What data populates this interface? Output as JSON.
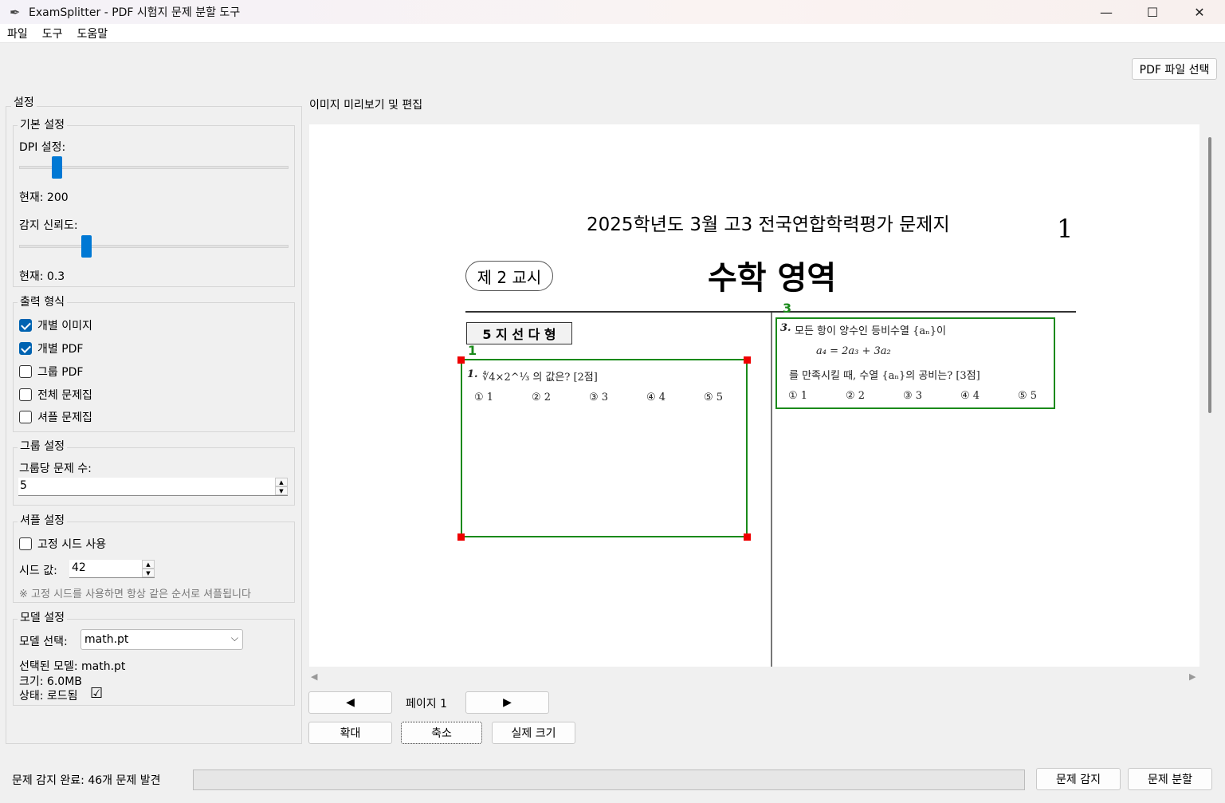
{
  "window": {
    "title": "ExamSplitter - PDF 시험지 문제 분할 도구",
    "minimize": "—",
    "maximize": "☐",
    "close": "✕"
  },
  "menu": [
    "파일",
    "도구",
    "도움말"
  ],
  "top": {
    "pdf_select": "PDF 파일 선택"
  },
  "settings": {
    "title": "설정",
    "basic": {
      "title": "기본 설정",
      "dpi_label": "DPI 설정:",
      "dpi_value": "현재: 200",
      "dpi_level": 0.12,
      "conf_label": "감지 신뢰도:",
      "conf_value": "현재: 0.3",
      "conf_level": 0.23
    },
    "output": {
      "title": "출력 형식",
      "options": [
        {
          "label": "개별 이미지",
          "checked": true
        },
        {
          "label": "개별 PDF",
          "checked": true
        },
        {
          "label": "그룹 PDF",
          "checked": false
        },
        {
          "label": "전체 문제집",
          "checked": false
        },
        {
          "label": "셔플 문제집",
          "checked": false
        }
      ]
    },
    "group": {
      "title": "그룹 설정",
      "count_label": "그룹당 문제 수:",
      "count_value": "5"
    },
    "shuffle": {
      "title": "셔플 설정",
      "fixed_seed": "고정 시드 사용",
      "seed_label": "시드 값:",
      "seed_value": "42",
      "note": "※ 고정 시드를 사용하면 항상 같은 순서로 셔플됩니다"
    },
    "model": {
      "title": "모델 설정",
      "select_label": "모델 선택:",
      "select_value": "math.pt",
      "selected": "선택된 모델: math.pt",
      "size": "크기: 6.0MB",
      "status": "상태: 로드됨",
      "status_icon": "☑"
    }
  },
  "preview": {
    "title": "이미지 미리보기 및 편집",
    "exam": {
      "header": "2025학년도 3월 고3 전국연합학력평가 문제지",
      "page_no": "1",
      "session": "제 2 교시",
      "subject": "수학 영역",
      "type_box": "5 지 선 다 형",
      "q1_num": "1.",
      "q1_text": "∜4×2^⅓ 의 값은? [2점]",
      "q1_choices": [
        "① 1",
        "② 2",
        "③ 3",
        "④ 4",
        "⑤ 5"
      ],
      "q3_num": "3.",
      "q3_line1": "모든 항이 양수인 등비수열 {aₙ}이",
      "q3_line2": "a₄ = 2a₃ + 3a₂",
      "q3_line3": "를 만족시킬 때, 수열 {aₙ}의 공비는? [3점]",
      "q3_choices": [
        "① 1",
        "② 2",
        "③ 3",
        "④ 4",
        "⑤ 5"
      ],
      "box_labels": [
        "1",
        "3"
      ]
    },
    "nav": {
      "prev": "◀",
      "page": "페이지 1",
      "next": "▶"
    },
    "zoom": {
      "in": "확대",
      "out": "축소",
      "actual": "실제 크기"
    }
  },
  "status": {
    "text": "문제 감지 완료: 46개 문제 발견",
    "detect": "문제 감지",
    "split": "문제 분할"
  }
}
